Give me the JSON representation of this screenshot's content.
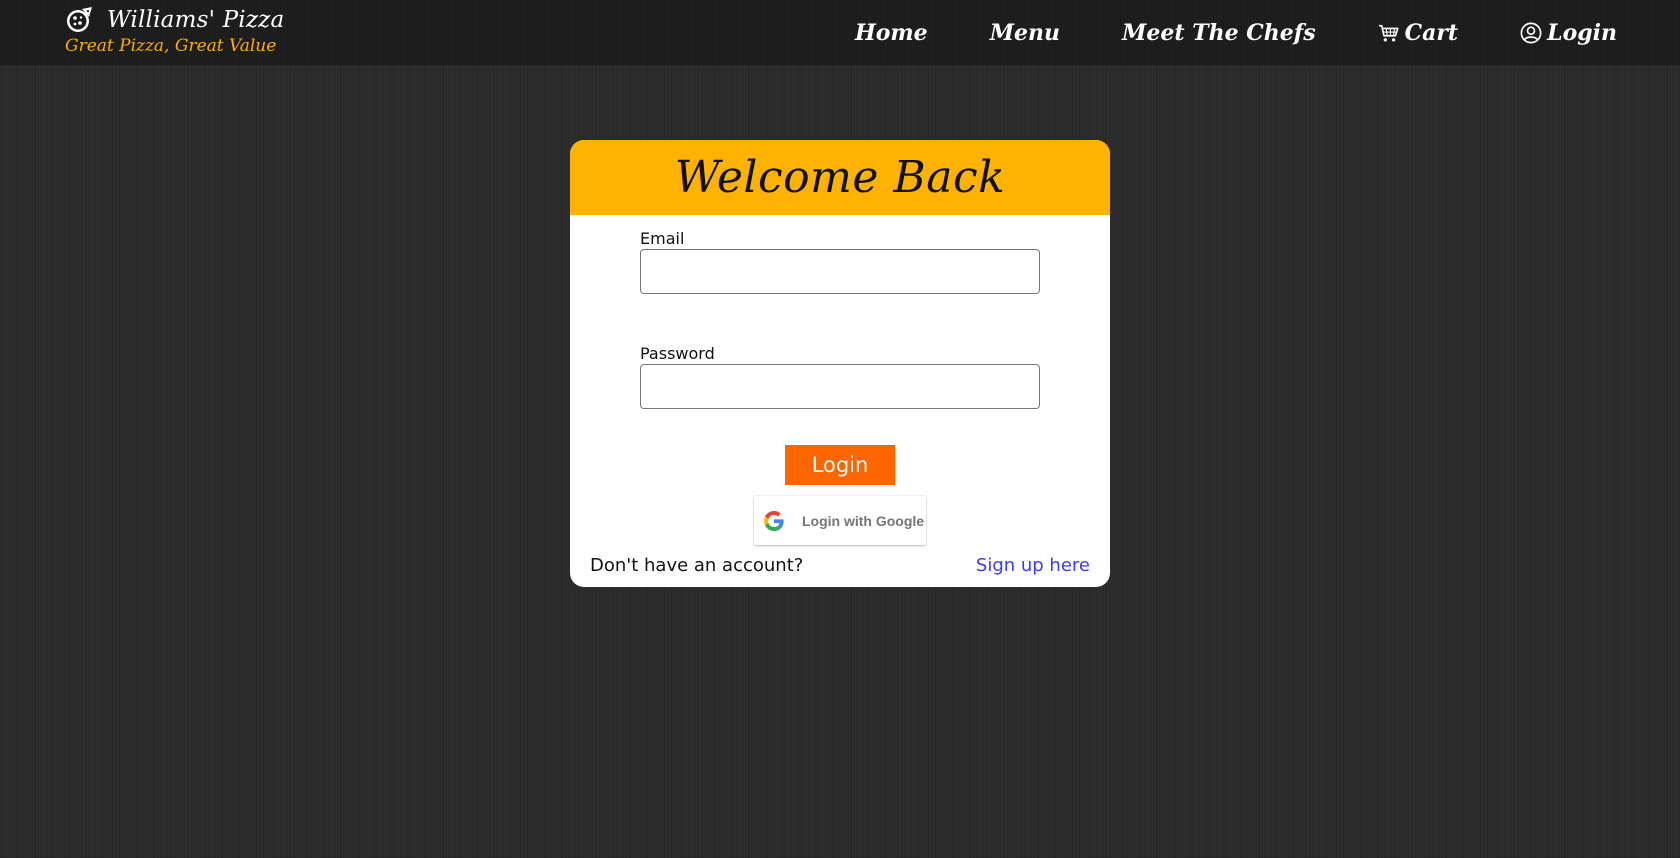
{
  "brand": {
    "name": "Williams' Pizza",
    "tagline": "Great Pizza, Great Value",
    "logo_icon": "pizza-icon"
  },
  "nav": {
    "items": [
      {
        "label": "Home"
      },
      {
        "label": "Menu"
      },
      {
        "label": "Meet The Chefs"
      },
      {
        "label": "Cart",
        "icon": "cart-icon"
      },
      {
        "label": "Login",
        "icon": "user-circle-icon"
      }
    ]
  },
  "login_card": {
    "title": "Welcome Back",
    "email": {
      "label": "Email",
      "value": "",
      "placeholder": ""
    },
    "password": {
      "label": "Password",
      "value": "",
      "placeholder": ""
    },
    "submit_label": "Login",
    "google_label": "Login with Google",
    "signup_prompt": "Don't have an account?",
    "signup_link": "Sign up here"
  },
  "colors": {
    "header_accent": "#ffb200",
    "tagline": "#ffae00",
    "login_button": "#ff6600",
    "link": "#3b3bf5",
    "page_background": "#2b2b2b"
  }
}
